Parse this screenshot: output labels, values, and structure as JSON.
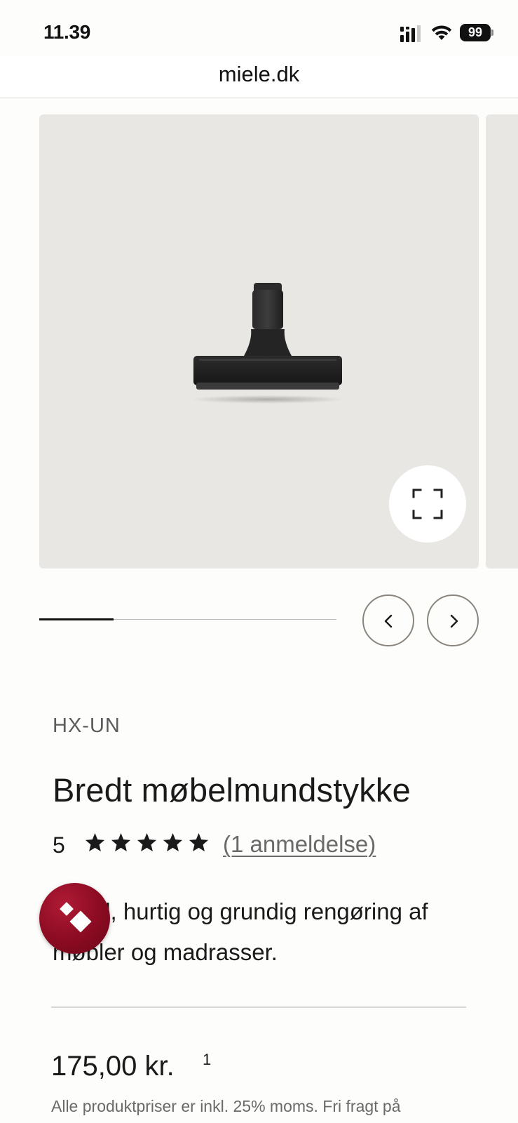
{
  "status_bar": {
    "time": "11.39",
    "battery": "99",
    "icons": [
      "signal-icon",
      "wifi-icon",
      "battery-icon"
    ]
  },
  "browser": {
    "url": "miele.dk"
  },
  "gallery": {
    "image_alt": "Bredt møbelmundstykke",
    "progress": 0.25,
    "icons": [
      "fullscreen-icon",
      "chevron-left-icon",
      "chevron-right-icon"
    ]
  },
  "product": {
    "sku": "HX-UN",
    "title": "Bredt møbelmundstykke",
    "rating": "5",
    "stars": 5,
    "reviews_link": "(1 anmeldelse)",
    "description": "Enkel, hurtig og grundig rengøring af møbler og madrasser.",
    "price": "175,00 kr.",
    "price_footnote": "1",
    "vat_note": "Alle produktpriser er inkl. 25% moms. Fri fragt på"
  },
  "colors": {
    "background": "#fdfdfc",
    "gallery_background": "#e9e7e4",
    "nav_button_border": "#8a857d",
    "widget": "#8a0b22",
    "text": "#1a1a1a",
    "muted_text": "#6a6a6a"
  }
}
